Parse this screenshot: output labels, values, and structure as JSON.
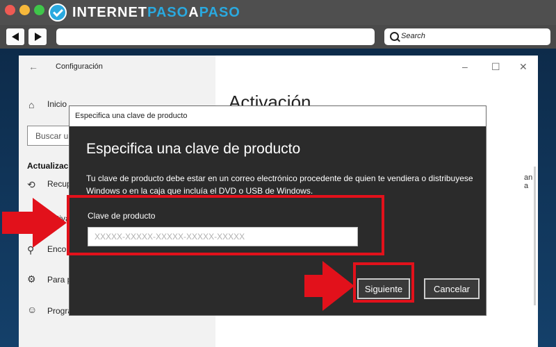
{
  "brand": {
    "part1": "INTERNET",
    "part2": "PASO",
    "part3": "A",
    "part4": "PASO"
  },
  "browser": {
    "search_placeholder": "Search"
  },
  "settings": {
    "window_title": "Configuración",
    "home_label": "Inicio",
    "search_label": "Buscar una configuración",
    "section_heading": "Actualización y seguridad",
    "items": [
      {
        "label": "Recuperación",
        "icon": "recovery-icon"
      },
      {
        "label": "Activación",
        "icon": "activation-icon"
      },
      {
        "label": "Encontrar mi dispositivo",
        "icon": "find-device-icon"
      },
      {
        "label": "Para programadores",
        "icon": "developer-icon"
      },
      {
        "label": "Programa Windows Insider",
        "icon": "insider-icon"
      }
    ],
    "main_heading": "Activación",
    "main_snippet": "an a"
  },
  "dialog": {
    "title": "Especifica una clave de producto",
    "heading": "Especifica una clave de producto",
    "description": "Tu clave de producto debe estar en un correo electrónico procedente de quien te vendiera o distribuyese Windows o en la caja que incluía el DVD o USB de Windows.",
    "field_label": "Clave de producto",
    "field_value": "",
    "field_placeholder": "XXXXX-XXXXX-XXXXX-XXXXX-XXXXX",
    "next_label": "Siguiente",
    "cancel_label": "Cancelar"
  },
  "colors": {
    "accent": "#2aa9df",
    "highlight": "#e2111b",
    "dialog_bg": "#2b2b2b"
  }
}
